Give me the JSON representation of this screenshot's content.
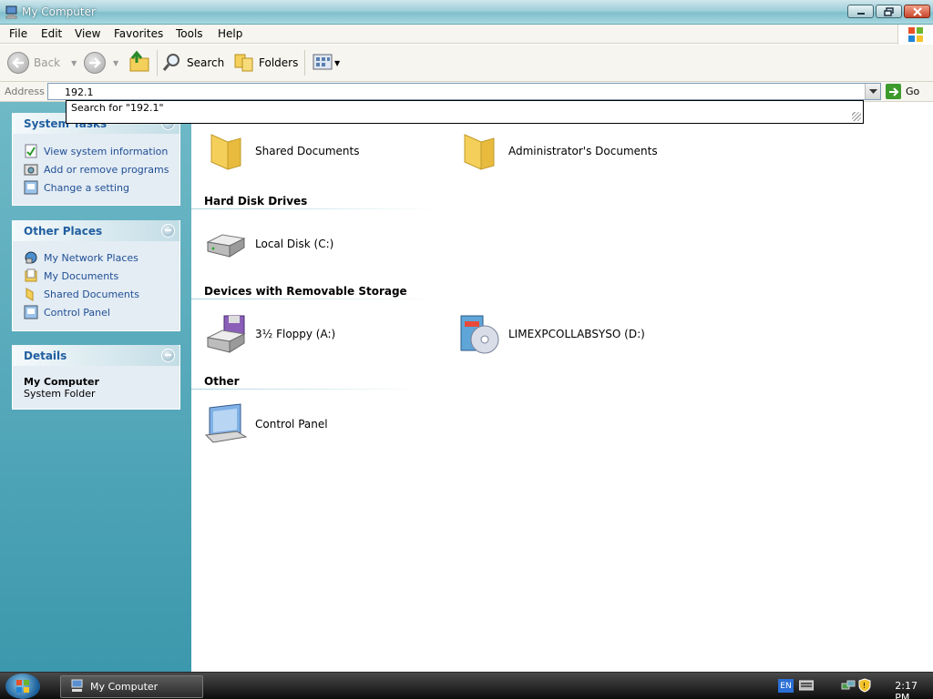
{
  "window": {
    "title": "My Computer"
  },
  "menu": [
    "File",
    "Edit",
    "View",
    "Favorites",
    "Tools",
    "Help"
  ],
  "toolbar": {
    "back": "Back",
    "search": "Search",
    "folders": "Folders"
  },
  "address": {
    "label": "Address",
    "value": "192.1",
    "go": "Go",
    "suggestion": "Search for \"192.1\""
  },
  "left": {
    "system_tasks": {
      "title": "System Tasks",
      "items": [
        "View system information",
        "Add or remove programs",
        "Change a setting"
      ]
    },
    "other_places": {
      "title": "Other Places",
      "items": [
        "My Network Places",
        "My Documents",
        "Shared Documents",
        "Control Panel"
      ]
    },
    "details": {
      "title": "Details",
      "name": "My Computer",
      "desc": "System Folder"
    }
  },
  "content": {
    "files": [
      "Shared Documents",
      "Administrator's Documents"
    ],
    "groups": {
      "hdd": "Hard Disk Drives",
      "removable": "Devices with Removable Storage",
      "other": "Other"
    },
    "hdd_items": [
      "Local Disk (C:)"
    ],
    "removable_items": [
      "3½ Floppy (A:)",
      "LIMEXPCOLLABSYSO (D:)"
    ],
    "other_items": [
      "Control Panel"
    ]
  },
  "taskbar": {
    "task": "My Computer",
    "lang": "EN",
    "clock": "2:17 PM"
  }
}
